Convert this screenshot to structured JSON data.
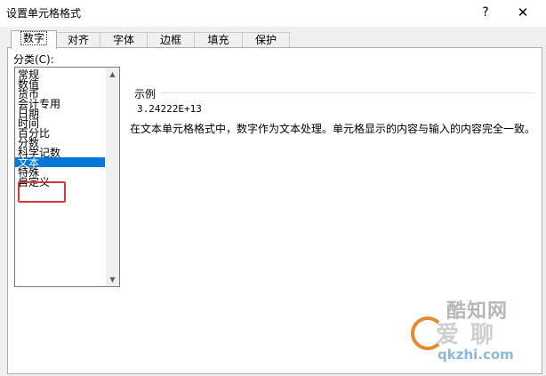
{
  "window": {
    "title": "设置单元格格式",
    "help_label": "?",
    "close_label": "✕"
  },
  "tabs": [
    {
      "label": "数字",
      "active": true
    },
    {
      "label": "对齐",
      "active": false
    },
    {
      "label": "字体",
      "active": false
    },
    {
      "label": "边框",
      "active": false
    },
    {
      "label": "填充",
      "active": false
    },
    {
      "label": "保护",
      "active": false
    }
  ],
  "category": {
    "label": "分类(C):",
    "items": [
      "常规",
      "数值",
      "货币",
      "会计专用",
      "日期",
      "时间",
      "百分比",
      "分数",
      "科学记数",
      "文本",
      "特殊",
      "自定义"
    ],
    "selected": "文本"
  },
  "sample": {
    "label": "示例",
    "value": "3.24222E+13"
  },
  "description": "在文本单元格格式中，数字作为文本处理。单元格显示的内容与输入的内容完全一致。",
  "watermark": {
    "line1": "酷知网",
    "line2": "爱 聊",
    "line3": "qkzhi.com"
  },
  "colors": {
    "selection": "#0078d7",
    "highlight_box": "#d9363e"
  }
}
